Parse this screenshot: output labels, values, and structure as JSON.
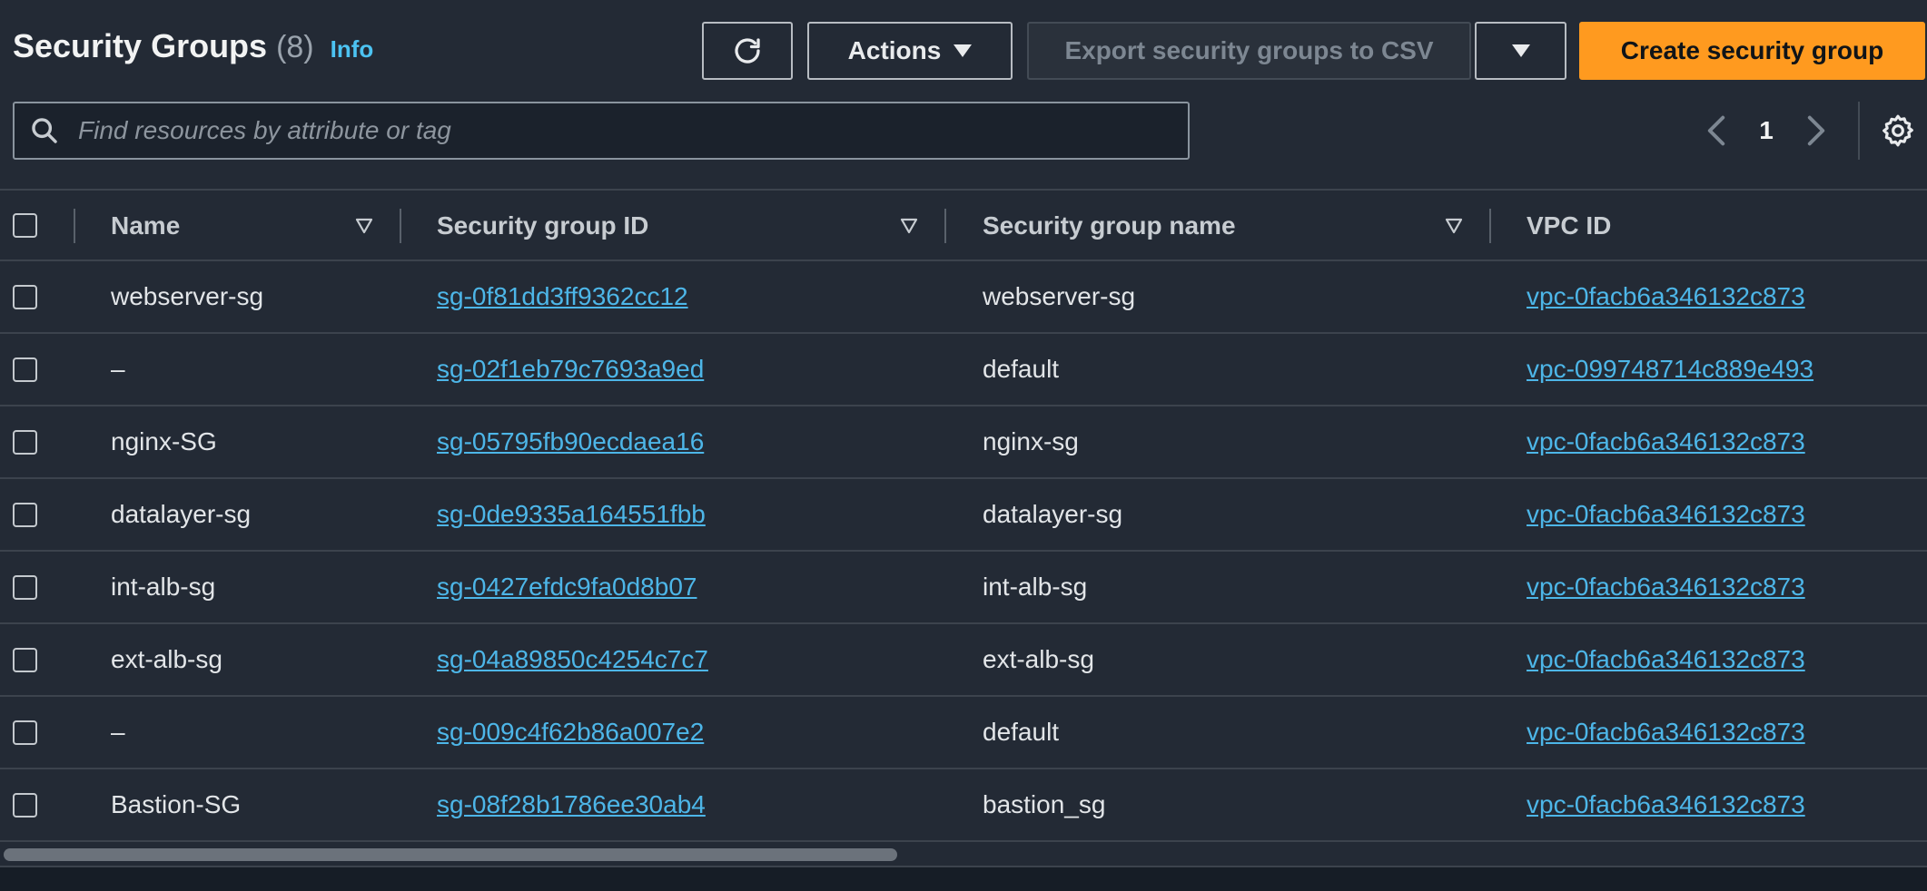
{
  "header": {
    "title": "Security Groups",
    "count": "(8)",
    "info": "Info",
    "actions_label": "Actions",
    "export_label": "Export security groups to CSV",
    "create_label": "Create security group"
  },
  "search": {
    "placeholder": "Find resources by attribute or tag",
    "value": ""
  },
  "pagination": {
    "current_page": "1"
  },
  "table": {
    "columns": [
      "Name",
      "Security group ID",
      "Security group name",
      "VPC ID"
    ],
    "rows": [
      {
        "name": "webserver-sg",
        "sg_id": "sg-0f81dd3ff9362cc12",
        "sg_name": "webserver-sg",
        "vpc_id": "vpc-0facb6a346132c873"
      },
      {
        "name": "–",
        "sg_id": "sg-02f1eb79c7693a9ed",
        "sg_name": "default",
        "vpc_id": "vpc-099748714c889e493"
      },
      {
        "name": "nginx-SG",
        "sg_id": "sg-05795fb90ecdaea16",
        "sg_name": "nginx-sg",
        "vpc_id": "vpc-0facb6a346132c873"
      },
      {
        "name": "datalayer-sg",
        "sg_id": "sg-0de9335a164551fbb",
        "sg_name": "datalayer-sg",
        "vpc_id": "vpc-0facb6a346132c873"
      },
      {
        "name": "int-alb-sg",
        "sg_id": "sg-0427efdc9fa0d8b07",
        "sg_name": "int-alb-sg",
        "vpc_id": "vpc-0facb6a346132c873"
      },
      {
        "name": "ext-alb-sg",
        "sg_id": "sg-04a89850c4254c7c7",
        "sg_name": "ext-alb-sg",
        "vpc_id": "vpc-0facb6a346132c873"
      },
      {
        "name": "–",
        "sg_id": "sg-009c4f62b86a007e2",
        "sg_name": "default",
        "vpc_id": "vpc-0facb6a346132c873"
      },
      {
        "name": "Bastion-SG",
        "sg_id": "sg-08f28b1786ee30ab4",
        "sg_name": "bastion_sg",
        "vpc_id": "vpc-0facb6a346132c873"
      }
    ]
  },
  "icons": {
    "refresh": "refresh-icon",
    "caret": "caret-down-icon",
    "search": "search-icon",
    "prev": "chevron-left-icon",
    "next": "chevron-right-icon",
    "settings": "gear-icon",
    "sort": "sort-down-icon"
  },
  "colors": {
    "background": "#232a35",
    "primary_button": "#ff9a1f",
    "link": "#4db6e8",
    "info": "#4cc3f2"
  }
}
